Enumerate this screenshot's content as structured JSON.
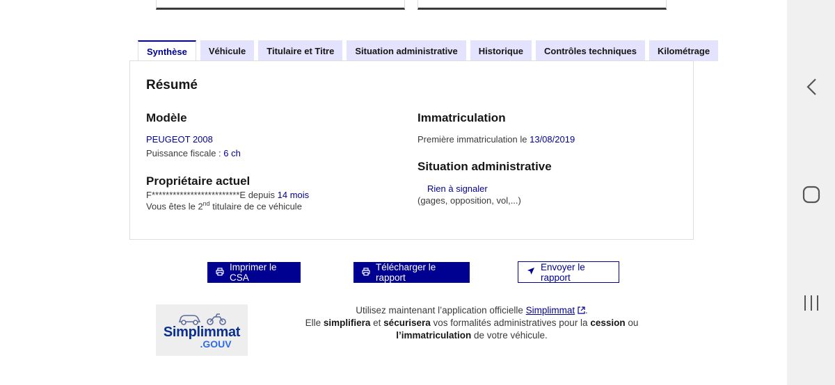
{
  "tabs": [
    {
      "label": "Synthèse",
      "active": true
    },
    {
      "label": "Véhicule",
      "active": false
    },
    {
      "label": "Titulaire et Titre",
      "active": false
    },
    {
      "label": "Situation administrative",
      "active": false
    },
    {
      "label": "Historique",
      "active": false
    },
    {
      "label": "Contrôles techniques",
      "active": false
    },
    {
      "label": "Kilométrage",
      "active": false
    }
  ],
  "summary": {
    "title": "Résumé",
    "model": {
      "heading": "Modèle",
      "name": "PEUGEOT 2008",
      "power_label": "Puissance fiscale : ",
      "power_value": "6 ch"
    },
    "owner": {
      "heading": "Propriétaire actuel",
      "masked_name": "F*************************E",
      "since_label": " depuis ",
      "since_value": "14 mois",
      "rank_prefix": "Vous êtes le 2",
      "rank_sup": "nd",
      "rank_suffix": " titulaire de ce véhicule"
    },
    "registration": {
      "heading": "Immatriculation",
      "first_label": "Première immatriculation le ",
      "first_date": "13/08/2019"
    },
    "admin": {
      "heading": "Situation administrative",
      "status": "Rien à signaler",
      "note": "(gages, opposition, vol,...)"
    }
  },
  "buttons": {
    "print": "Imprimer le CSA",
    "download": "Télécharger le rapport",
    "send": "Envoyer le rapport"
  },
  "promo": {
    "line1_prefix": "Utilisez maintenant l’application officielle ",
    "app_name": "Simplimmat",
    "line1_suffix": ".",
    "line2_a": "Elle ",
    "simplify": "simplifiera",
    "and": " et ",
    "secure": "sécurisera",
    "line2_b": " vos formalités administratives pour la ",
    "cession": "cession",
    "or": " ou ",
    "immat": "l’immatriculation",
    "line2_c": " de votre véhicule.",
    "logo_text": "Simplimmat",
    "logo_gouv": ".GOUV"
  },
  "colors": {
    "accent": "#000091",
    "tab_bg": "#e3e3fd"
  }
}
